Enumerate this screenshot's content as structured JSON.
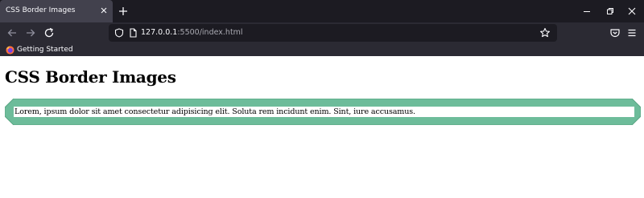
{
  "browser": {
    "tab": {
      "title": "CSS Border Images"
    },
    "url": {
      "host": "127.0.0.1",
      "rest": ":5500/index.html"
    },
    "bookmarks": [
      {
        "label": "Getting Started"
      }
    ],
    "colors": {
      "tabstrip_bg": "#1c1b22",
      "active_tab_bg": "#42414d",
      "toolbar_bg": "#2b2a33",
      "urlbar_bg": "#1c1b22"
    }
  },
  "page": {
    "heading": "CSS Border Images",
    "paragraph": "Lorem, ipsum dolor sit amet consectetur adipisicing elit. Soluta rem incidunt enim. Sint, iure accusamus.",
    "border_color": "#6dbc9a",
    "border_edge_color": "#5aa583"
  }
}
